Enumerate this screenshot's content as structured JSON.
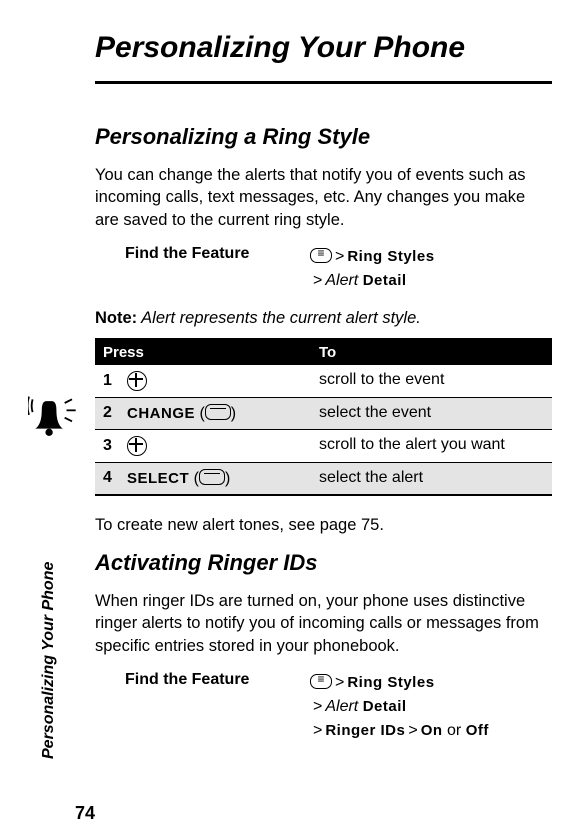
{
  "sideLabel": "Personalizing Your Phone",
  "pageNumber": "74",
  "mainTitle": "Personalizing Your Phone",
  "section1": {
    "title": "Personalizing a Ring Style",
    "intro": "You can change the alerts that notify you of events such as incoming calls, text messages, etc. Any changes you make are saved to the current ring style.",
    "featureLabel": "Find the Feature",
    "path1a": "Ring Styles",
    "path1b": "Alert",
    "path1c": "Detail",
    "noteLabel": "Note:",
    "noteText": " Alert represents the current alert style.",
    "tableHeader1": "Press",
    "tableHeader2": "To",
    "rows": [
      {
        "num": "1",
        "press": "nav",
        "to": "scroll to the event"
      },
      {
        "num": "2",
        "press": "CHANGE",
        "icon": "softkey",
        "to": "select the event"
      },
      {
        "num": "3",
        "press": "nav",
        "to": "scroll to the alert you want"
      },
      {
        "num": "4",
        "press": "SELECT",
        "icon": "softkey",
        "to": "select the alert"
      }
    ],
    "outro": "To create new alert tones, see page 75."
  },
  "section2": {
    "title": "Activating Ringer IDs",
    "intro": "When ringer IDs are turned on, your phone uses distinctive ringer alerts to notify you of incoming calls or messages from specific entries stored in your phonebook.",
    "featureLabel": "Find the Feature",
    "path_a": "Ring Styles",
    "path_b": "Alert",
    "path_c": "Detail",
    "path_d": "Ringer IDs",
    "path_e": "On",
    "path_f": "or",
    "path_g": "Off"
  }
}
